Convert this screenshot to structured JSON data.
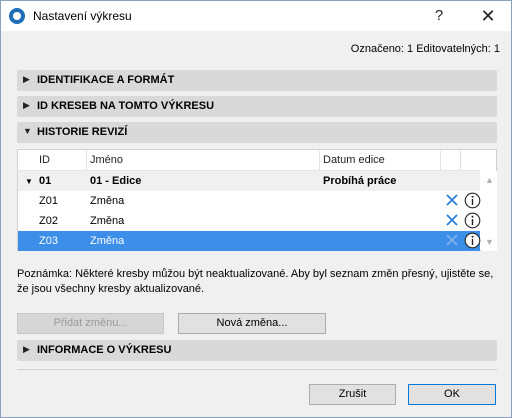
{
  "window": {
    "title": "Nastavení výkresu",
    "help_glyph": "?",
    "close_glyph": "✕"
  },
  "selection_info": "Označeno: 1 Editovatelných: 1",
  "sections": [
    {
      "label": "IDENTIFIKACE A FORMÁT",
      "expanded": false
    },
    {
      "label": "ID KRESEB NA TOMTO VÝKRESU",
      "expanded": false
    },
    {
      "label": "HISTORIE REVIZÍ",
      "expanded": true
    },
    {
      "label": "INFORMACE O VÝKRESU",
      "expanded": false
    }
  ],
  "revision_table": {
    "columns": [
      "ID",
      "Jméno",
      "Datum edice"
    ],
    "group": {
      "id": "01",
      "name": "01 - Edice",
      "date": "Probíhá práce"
    },
    "rows": [
      {
        "id": "Z01",
        "name": "Změna",
        "selected": false
      },
      {
        "id": "Z02",
        "name": "Změna",
        "selected": false
      },
      {
        "id": "Z03",
        "name": "Změna",
        "selected": true
      }
    ]
  },
  "note": "Poznámka: Některé kresby můžou být neaktualizované. Aby byl seznam změn přesný, ujistěte se, že jsou všechny kresby aktualizované.",
  "buttons": {
    "add_change": "Přidat změnu...",
    "new_change": "Nová změna...",
    "cancel": "Zrušit",
    "ok": "OK"
  },
  "colors": {
    "selection": "#3d8ee8",
    "accent_icon": "#2a7fd4",
    "section_bg": "#d9d9d9"
  }
}
